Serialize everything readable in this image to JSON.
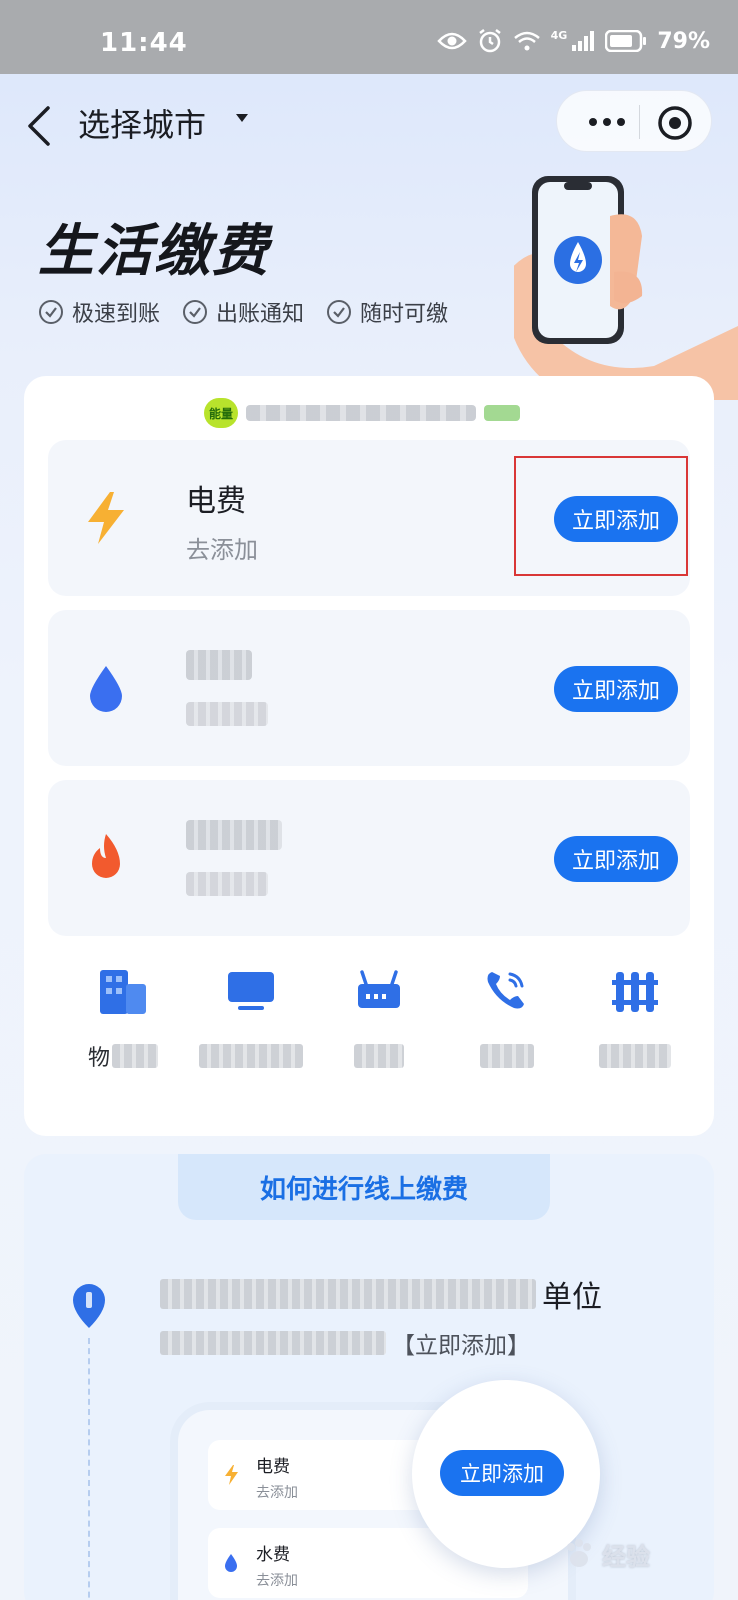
{
  "status_bar": {
    "time": "11:44",
    "network": "4G",
    "battery": "79%"
  },
  "nav": {
    "title": "选择城市"
  },
  "hero": {
    "title": "生活缴费",
    "features": [
      "极速到账",
      "出账通知",
      "随时可缴"
    ]
  },
  "notice": {
    "badge": "能量"
  },
  "bills": [
    {
      "name": "电费",
      "sub": "去添加",
      "button": "立即添加",
      "icon": "lightning-icon"
    },
    {
      "name": "",
      "sub": "",
      "button": "立即添加",
      "icon": "water-drop-icon"
    },
    {
      "name": "",
      "sub": "",
      "button": "立即添加",
      "icon": "flame-icon"
    }
  ],
  "quick_services": [
    {
      "label_prefix": "物",
      "icon": "building-icon"
    },
    {
      "label_prefix": "",
      "icon": "tv-icon"
    },
    {
      "label_prefix": "",
      "icon": "router-icon"
    },
    {
      "label_prefix": "",
      "icon": "phone-call-icon"
    },
    {
      "label_prefix": "",
      "icon": "heater-icon"
    }
  ],
  "guide": {
    "tab": "如何进行线上缴费",
    "step_title_suffix": "单位",
    "step_desc_suffix": "【立即添加】",
    "demo_rows": [
      {
        "name": "电费",
        "sub": "去添加"
      },
      {
        "name": "水费",
        "sub": "去添加"
      }
    ],
    "demo_button": "立即添加"
  },
  "watermark": {
    "text": "经验"
  },
  "colors": {
    "accent": "#1a73f0",
    "highlight": "#d93636",
    "energy": "#b8e32c"
  }
}
